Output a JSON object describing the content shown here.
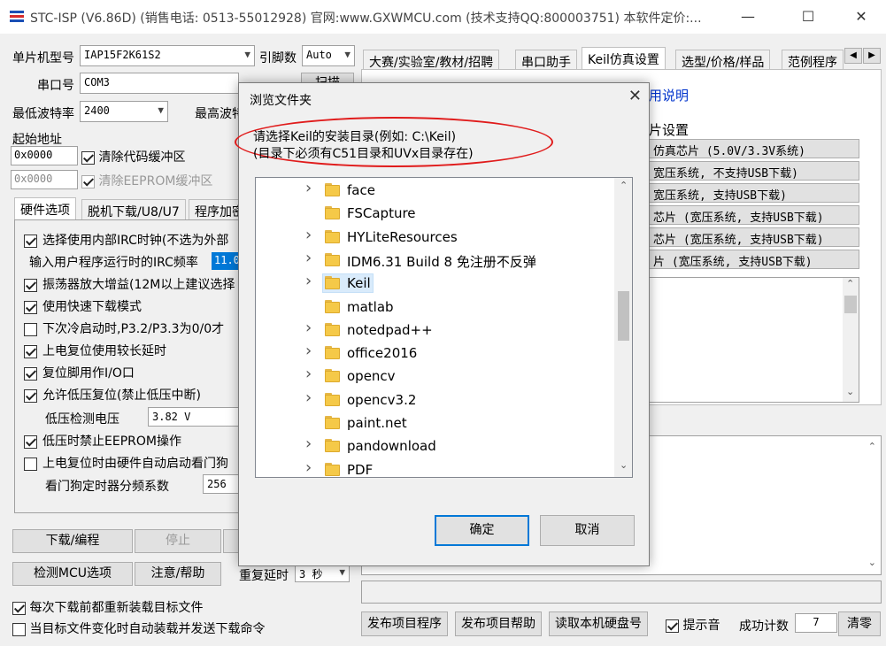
{
  "window": {
    "title": "STC-ISP (V6.86D) (销售电话: 0513-55012928) 官网:www.GXWMCU.com  (技术支持QQ:800003751) 本软件定价:...",
    "minimize": "—",
    "maximize": "☐",
    "close": "✕"
  },
  "left": {
    "mcu_label": "单片机型号",
    "mcu_value": "IAP15F2K61S2",
    "pins_label": "引脚数",
    "pins_value": "Auto",
    "port_label": "串口号",
    "port_value": "COM3",
    "scan_btn": "扫描",
    "min_baud_label": "最低波特率",
    "min_baud_value": "2400",
    "max_baud_label": "最高波特",
    "start_addr_label": "起始地址",
    "addr1_value": "0x0000",
    "clear_code_label": "清除代码缓冲区",
    "addr2_value": "0x0000",
    "clear_eeprom_label": "清除EEPROM缓冲区",
    "tabs": [
      "硬件选项",
      "脱机下载/U8/U7",
      "程序加密"
    ],
    "options": [
      {
        "label": "选择使用内部IRC时钟(不选为外部",
        "checked": true
      },
      {
        "label": "输入用户程序运行时的IRC频率",
        "checked": null
      },
      {
        "label": "振荡器放大增益(12M以上建议选择",
        "checked": true
      },
      {
        "label": "使用快速下载模式",
        "checked": true
      },
      {
        "label": "下次冷启动时,P3.2/P3.3为0/0才",
        "checked": false
      },
      {
        "label": "上电复位使用较长延时",
        "checked": true
      },
      {
        "label": "复位脚用作I/O口",
        "checked": true
      },
      {
        "label": "允许低压复位(禁止低压中断)",
        "checked": true
      },
      {
        "label": "低压检测电压",
        "checked": null
      },
      {
        "label": "低压时禁止EEPROM操作",
        "checked": true
      },
      {
        "label": "上电复位时由硬件自动启动看门狗",
        "checked": false
      },
      {
        "label": "看门狗定时器分频系数",
        "checked": null
      }
    ],
    "irc_freq_value": "11.0",
    "lv_value": "3.82 V",
    "wdt_value": "256",
    "download_btn": "下载/编程",
    "stop_btn": "停止",
    "detect_btn": "检测MCU选项",
    "help_btn": "注意/帮助",
    "repeat_delay_label": "重复延时",
    "repeat_delay_value": "3 秒",
    "reload_label": "每次下载前都重新装载目标文件",
    "autosend_label": "当目标文件变化时自动装载并发送下载命令"
  },
  "right": {
    "tabs": [
      "大赛/实验室/教材/招聘",
      "串口助手",
      "Keil仿真设置",
      "选型/价格/样品",
      "范例程序"
    ],
    "help_link": "用说明",
    "group_title": "片设置",
    "chip_buttons": [
      "仿真芯片 (5.0V/3.3V系统)",
      "宽压系统, 不支持USB下载)",
      "宽压系统, 支持USB下载)",
      "芯片 (宽压系统, 支持USB下载)",
      "芯片 (宽压系统, 支持USB下载)",
      "片 (宽压系统, 支持USB下载)"
    ],
    "publish_prog_btn": "发布项目程序",
    "publish_help_btn": "发布项目帮助",
    "read_disk_btn": "读取本机硬盘号",
    "beep_label": "提示音",
    "success_label": "成功计数",
    "success_value": "7",
    "clear_btn": "清零"
  },
  "dialog": {
    "title": "浏览文件夹",
    "instruction_line1": "请选择Keil的安装目录(例如: C:\\Keil)",
    "instruction_line2": "(目录下必须有C51目录和UVx目录存在)",
    "folders": [
      {
        "name": "face",
        "expandable": true
      },
      {
        "name": "FSCapture",
        "expandable": false
      },
      {
        "name": "HYLiteResources",
        "expandable": true
      },
      {
        "name": "IDM6.31 Build 8 免注册不反弹",
        "expandable": true
      },
      {
        "name": "Keil",
        "expandable": true,
        "selected": true
      },
      {
        "name": "matlab",
        "expandable": false
      },
      {
        "name": "notedpad++",
        "expandable": true
      },
      {
        "name": "office2016",
        "expandable": true
      },
      {
        "name": "opencv",
        "expandable": true
      },
      {
        "name": "opencv3.2",
        "expandable": true
      },
      {
        "name": "paint.net",
        "expandable": false
      },
      {
        "name": "pandownload",
        "expandable": true
      },
      {
        "name": "PDF",
        "expandable": true
      }
    ],
    "ok_btn": "确定",
    "cancel_btn": "取消"
  }
}
